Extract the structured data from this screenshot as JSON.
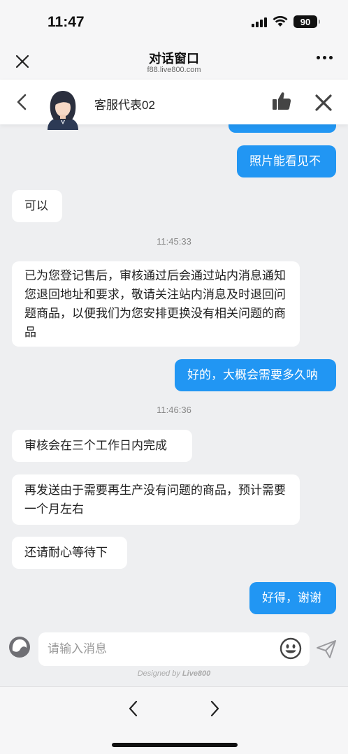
{
  "status_bar": {
    "time": "11:47",
    "battery": "90"
  },
  "browser": {
    "title": "对话窗口",
    "url": "f88.live800.com"
  },
  "chat_header": {
    "agent_name": "客服代表02"
  },
  "messages": [
    {
      "side": "out",
      "text": ""
    },
    {
      "side": "out",
      "text": "照片能看见不"
    },
    {
      "side": "in",
      "text": "可以"
    },
    {
      "side": "time",
      "text": "11:45:33"
    },
    {
      "side": "in",
      "text": "已为您登记售后，审核通过后会通过站内消息通知您退回地址和要求，敬请关注站内消息及时退回问题商品，以便我们为您安排更换没有相关问题的商品"
    },
    {
      "side": "out",
      "text": "好的，大概会需要多久呐"
    },
    {
      "side": "time",
      "text": "11:46:36"
    },
    {
      "side": "in",
      "text": "审核会在三个工作日内完成"
    },
    {
      "side": "in",
      "text": "再发送由于需要再生产没有问题的商品，预计需要一个月左右"
    },
    {
      "side": "in",
      "text": "还请耐心等待下"
    },
    {
      "side": "out",
      "text": "好得，谢谢"
    }
  ],
  "input": {
    "placeholder": "请输入消息"
  },
  "footer": {
    "designed_by": "Designed by",
    "brand": "Live800"
  },
  "colors": {
    "accent": "#2196f3",
    "background": "#eeeff1",
    "incoming_bubble": "#ffffff"
  },
  "icons": [
    "close-icon",
    "more-icon",
    "back-chevron-icon",
    "agent-avatar",
    "thumbs-up-icon",
    "close-x-icon",
    "theme-icon",
    "emoji-icon",
    "send-icon",
    "nav-back-icon",
    "nav-forward-icon"
  ]
}
